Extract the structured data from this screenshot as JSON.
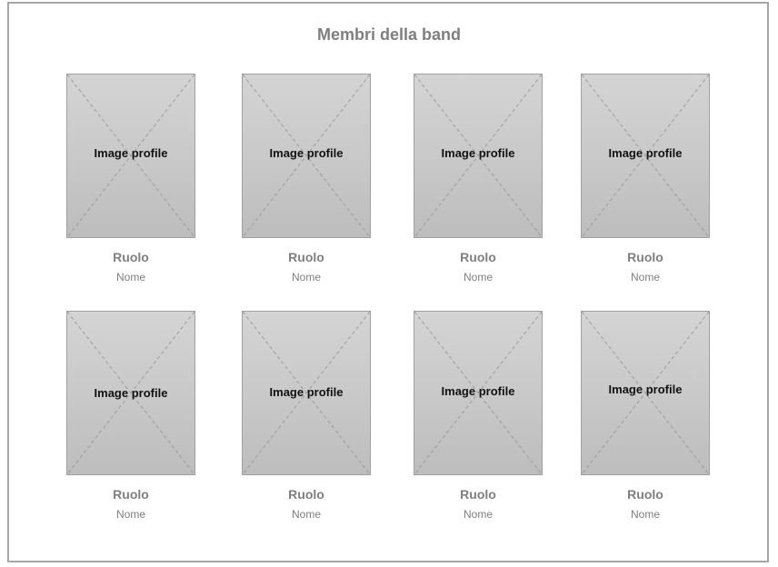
{
  "page": {
    "title": "Membri della band"
  },
  "members": [
    {
      "image_label": "Image profile",
      "role": "Ruolo",
      "name": "Nome"
    },
    {
      "image_label": "Image profile",
      "role": "Ruolo",
      "name": "Nome"
    },
    {
      "image_label": "Image profile",
      "role": "Ruolo",
      "name": "Nome"
    },
    {
      "image_label": "Image profile",
      "role": "Ruolo",
      "name": "Nome"
    },
    {
      "image_label": "Image profile",
      "role": "Ruolo",
      "name": "Nome"
    },
    {
      "image_label": "Image profile",
      "role": "Ruolo",
      "name": "Nome"
    },
    {
      "image_label": "Image profile",
      "role": "Ruolo",
      "name": "Nome"
    },
    {
      "image_label": "Image profile",
      "role": "Ruolo",
      "name": "Nome"
    }
  ],
  "colors": {
    "frame_border": "#a6a6a6",
    "muted_text": "#7f7f7f",
    "placeholder_fill": "#c8c8c8"
  }
}
